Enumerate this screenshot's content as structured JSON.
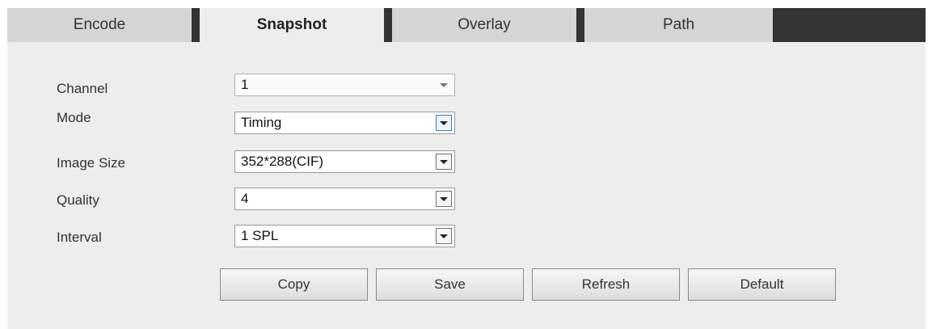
{
  "tabs": [
    {
      "label": "Encode"
    },
    {
      "label": "Snapshot"
    },
    {
      "label": "Overlay"
    },
    {
      "label": "Path"
    }
  ],
  "active_tab": "Snapshot",
  "form": {
    "channel": {
      "label": "Channel",
      "value": "1",
      "disabled": true
    },
    "mode": {
      "label": "Mode",
      "value": "Timing",
      "focused": true
    },
    "image_size": {
      "label": "Image Size",
      "value": "352*288(CIF)"
    },
    "quality": {
      "label": "Quality",
      "value": "4"
    },
    "interval": {
      "label": "Interval",
      "value": "1 SPL"
    }
  },
  "buttons": {
    "copy": "Copy",
    "save": "Save",
    "refresh": "Refresh",
    "default": "Default"
  },
  "icons": {
    "dropdown": "chevron-down-icon"
  },
  "colors": {
    "tab_bar": "#333333",
    "tab_inactive": "#d5d5d5",
    "tab_active": "#ededed",
    "panel": "#ededed"
  }
}
